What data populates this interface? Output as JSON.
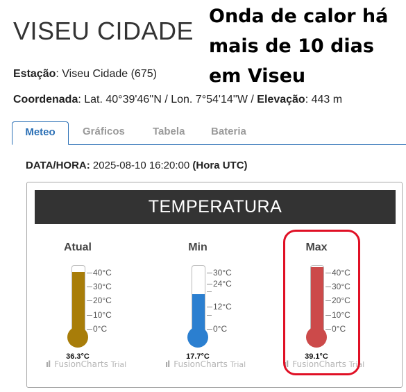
{
  "station": {
    "title": "VISEU CIDADE",
    "estacao_label": "Estação",
    "estacao_value": ": Viseu Cidade (675)",
    "coord_label": "Coordenada",
    "coord_value": ": Lat. 40°39'46''N / Lon. 7°54'14''W / ",
    "elev_label": "Elevação",
    "elev_value": ": 443 m"
  },
  "headline": {
    "line1": "Onda de calor há",
    "line2": "mais de 10 dias",
    "line3": "em Viseu"
  },
  "tabs": {
    "meteo": "Meteo",
    "graficos": "Gráficos",
    "tabela": "Tabela",
    "bateria": "Bateria"
  },
  "datetime": {
    "label": "DATA/HORA:",
    "value": " 2025-08-10 16:20:00 ",
    "tz": "(Hora UTC)"
  },
  "panel": {
    "title": "TEMPERATURA"
  },
  "gauges": {
    "atual": {
      "label": "Atual",
      "value": "36.3°C",
      "fill_fraction": 0.909,
      "color": "#a87d09",
      "ticks": [
        "40°C",
        "30°C",
        "20°C",
        "10°C",
        "0°C"
      ]
    },
    "min": {
      "label": "Min",
      "value": "17.7°C",
      "fill_fraction": 0.59,
      "color": "#2b7fd0",
      "ticks": [
        "30°C",
        "24°C",
        "12°C",
        "0°C"
      ]
    },
    "max": {
      "label": "Max",
      "value": "39.1°C",
      "fill_fraction": 0.978,
      "color": "#cc4a4a",
      "ticks": [
        "40°C",
        "30°C",
        "20°C",
        "10°C",
        "0°C"
      ]
    }
  },
  "watermark": {
    "logo": "ıl",
    "brand": "FusionCharts",
    "trial": "Trial"
  },
  "colors": {
    "accent": "#2a6fb5",
    "header_bg": "#333333",
    "highlight": "#e01025"
  }
}
